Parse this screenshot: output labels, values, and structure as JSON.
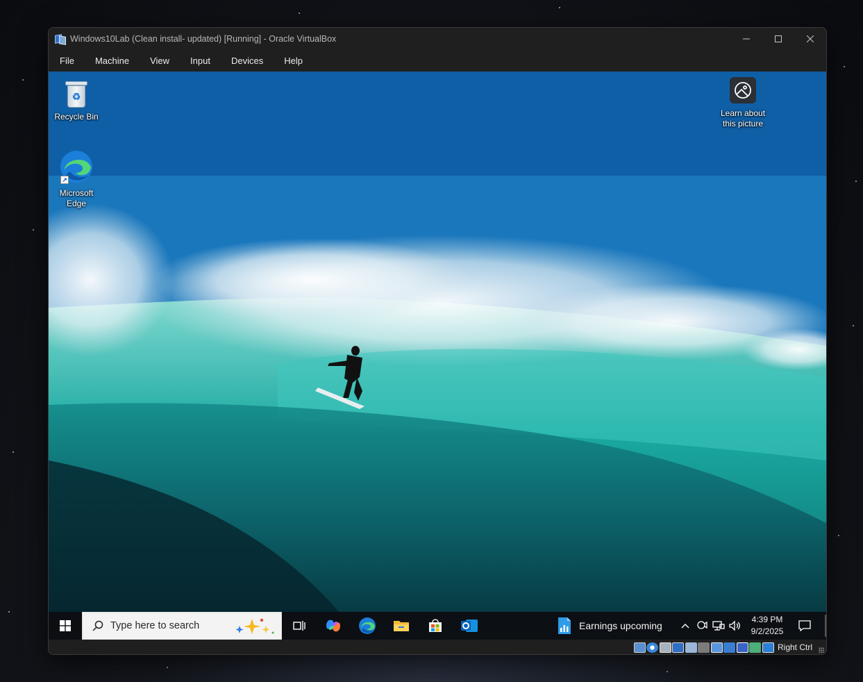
{
  "window": {
    "title": "Windows10Lab (Clean install- updated) [Running] - Oracle VirtualBox",
    "controls": [
      "minimize",
      "maximize",
      "close"
    ]
  },
  "menu": {
    "items": [
      "File",
      "Machine",
      "View",
      "Input",
      "Devices",
      "Help"
    ]
  },
  "desktop": {
    "icons": [
      {
        "label": "Recycle Bin",
        "icon": "recycle-bin-icon"
      },
      {
        "label": "Microsoft\nEdge",
        "icon": "edge-icon"
      }
    ],
    "spotlight": {
      "line1": "Learn about",
      "line2": "this picture",
      "icon": "spotlight-camera-icon"
    }
  },
  "taskbar": {
    "search_placeholder": "Type here to search",
    "apps": [
      "task-view-icon",
      "copilot-icon",
      "edge-icon",
      "file-explorer-icon",
      "store-icon",
      "outlook-icon"
    ],
    "widget_text": "Earnings upcoming",
    "tray": [
      "chevron-up-icon",
      "meet-now-icon",
      "network-icon",
      "volume-icon"
    ],
    "time": "4:39 PM",
    "date": "9/2/2025"
  },
  "statusbar": {
    "host_key": "Right Ctrl",
    "indicators": [
      "hard-disk-icon",
      "optical-drive-icon",
      "audio-icon",
      "network-adapter-icon",
      "usb-icon",
      "shared-folder-icon",
      "display-icon",
      "recording-icon",
      "cpu-virtualization-icon",
      "mouse-integration-icon",
      "keyboard-capture-icon"
    ]
  },
  "colors": {
    "chrome": "#1f1f1f",
    "taskbar": "#0c0e12",
    "accent": "#0078d4"
  }
}
